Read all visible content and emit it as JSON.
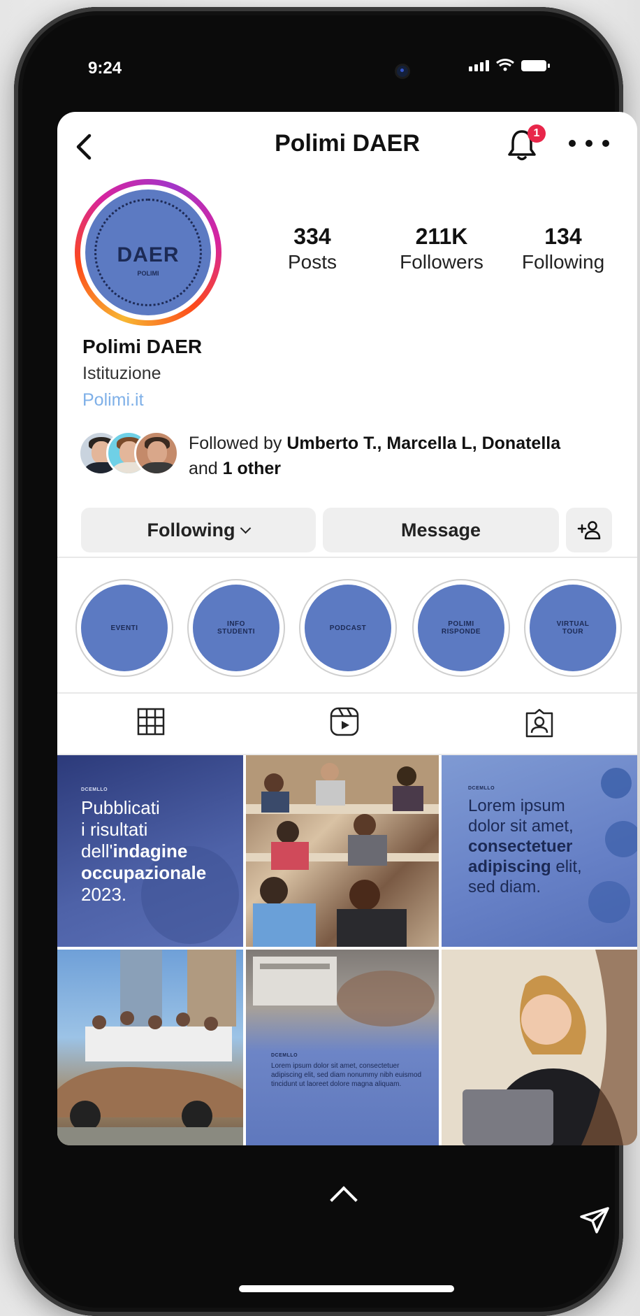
{
  "status_bar": {
    "time": "9:24"
  },
  "header": {
    "title": "Polimi DAER",
    "notification_count": "1"
  },
  "profile": {
    "avatar_text": "DAER",
    "avatar_subtext": "POLIMI",
    "stats": [
      {
        "value": "334",
        "label": "Posts"
      },
      {
        "value": "211K",
        "label": "Followers"
      },
      {
        "value": "134",
        "label": "Following"
      }
    ],
    "name": "Polimi DAER",
    "category": "Istituzione",
    "link": "Polimi.it",
    "followed_by": {
      "prefix": "Followed by ",
      "names": "Umberto T., Marcella L, Donatella",
      "and": " and ",
      "others": "1 other"
    }
  },
  "actions": {
    "following_label": "Following",
    "message_label": "Message"
  },
  "highlights": [
    {
      "label": "EVENTI"
    },
    {
      "label": "INFO\nSTUDENTI"
    },
    {
      "label": "PODCAST"
    },
    {
      "label": "POLIMI\nRISPONDE"
    },
    {
      "label": "VIRTUAL\nTOUR"
    }
  ],
  "tabs": [
    {
      "icon": "grid-icon"
    },
    {
      "icon": "reels-icon"
    },
    {
      "icon": "tagged-icon"
    }
  ],
  "posts": [
    {
      "tag": "DCEMLLO",
      "text_lines": [
        "Pubblicati",
        "i risultati",
        "dell'",
        "indagine",
        "occupazionale",
        "2023."
      ]
    },
    {
      "image": "students-in-lecture-hall"
    },
    {
      "tag": "DCEMLLO",
      "text_lines": [
        "Lorem ipsum",
        "dolor sit amet,",
        "consectetuer",
        "adipiscing",
        " elit,",
        "sed diam."
      ]
    },
    {
      "image": "team-with-car"
    },
    {
      "tag": "DCEMLLO",
      "text": "Lorem ipsum dolor sit amet, consectetuer adipiscing elit, sed diam nonummy nibh euismod tincidunt ut laoreet dolore magna aliquam."
    },
    {
      "image": "smiling-student-laptop"
    }
  ],
  "colors": {
    "brand_blue": "#5c7ac2",
    "badge_red": "#e8264a",
    "link_blue": "#7fb0e8"
  }
}
